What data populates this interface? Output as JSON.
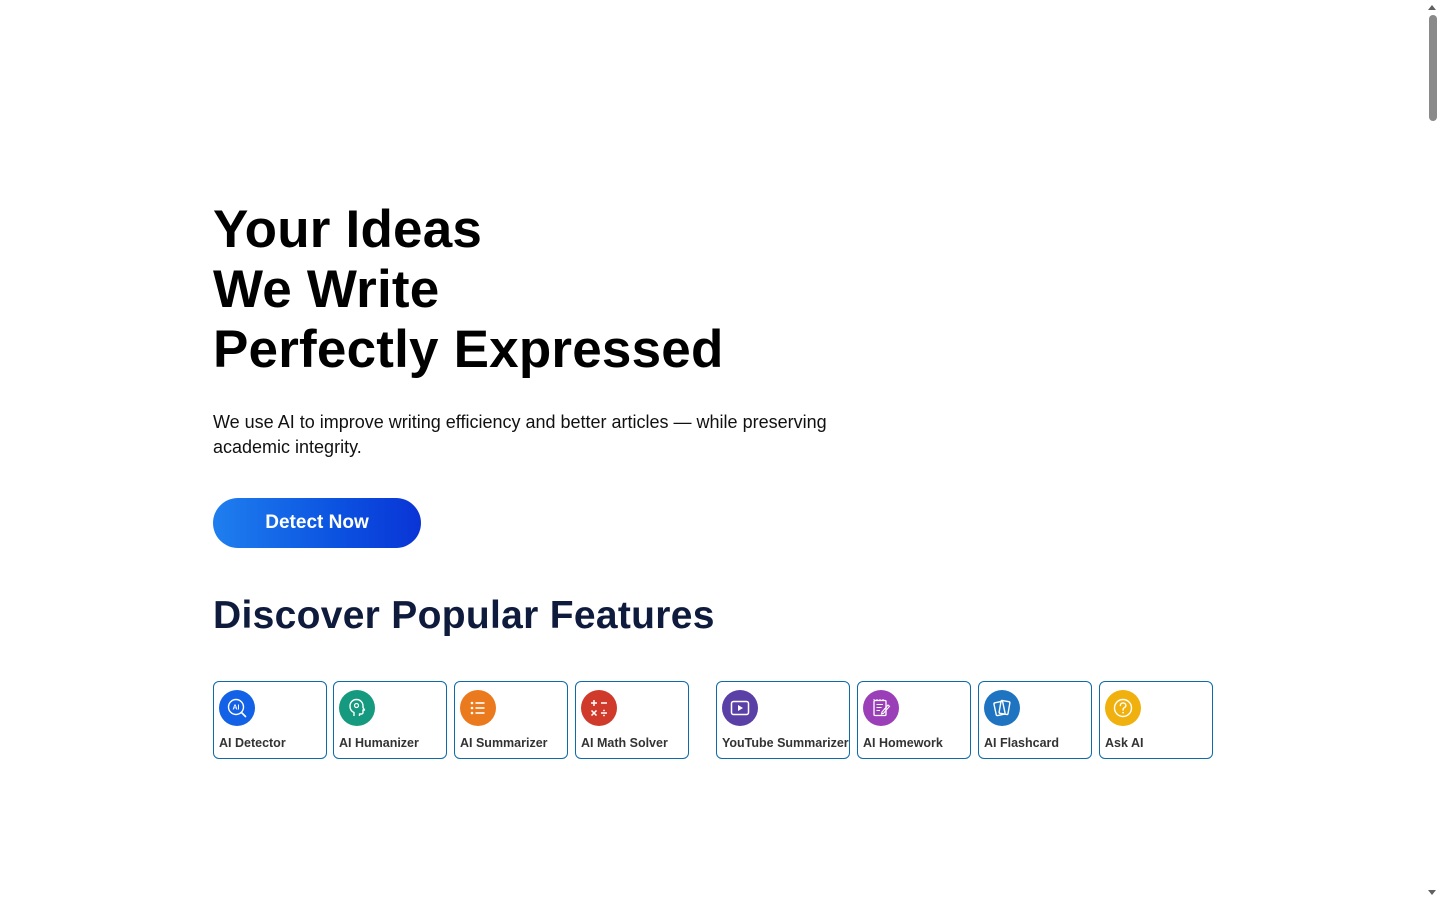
{
  "hero": {
    "title_lines": [
      "Your Ideas",
      "We Write",
      "Perfectly Expressed"
    ],
    "subtitle": "We use AI to improve writing efficiency and better articles — while preserving academic integrity.",
    "cta_label": "Detect Now"
  },
  "features": {
    "title": "Discover Popular Features",
    "items": [
      {
        "label": "AI Detector",
        "icon": "ai-detector-icon",
        "color": "#1361e6"
      },
      {
        "label": "AI Humanizer",
        "icon": "humanizer-head-icon",
        "color": "#159a7f"
      },
      {
        "label": "AI Summarizer",
        "icon": "list-icon",
        "color": "#eb7a1f"
      },
      {
        "label": "AI Math Solver",
        "icon": "math-symbols-icon",
        "color": "#cf3a2a"
      },
      {
        "label": "YouTube Summarizer",
        "icon": "video-play-icon",
        "color": "#5a3fa6"
      },
      {
        "label": "AI Homework",
        "icon": "notebook-pen-icon",
        "color": "#9b3fb8"
      },
      {
        "label": "AI Flashcard",
        "icon": "flashcards-icon",
        "color": "#1f74c2"
      },
      {
        "label": "Ask AI",
        "icon": "question-icon",
        "color": "#f0b00e"
      }
    ]
  },
  "colors": {
    "cta_gradient_start": "#1f7fef",
    "cta_gradient_end": "#0a34d6",
    "card_border": "#0d6ba8",
    "features_title": "#0f1b3d"
  }
}
